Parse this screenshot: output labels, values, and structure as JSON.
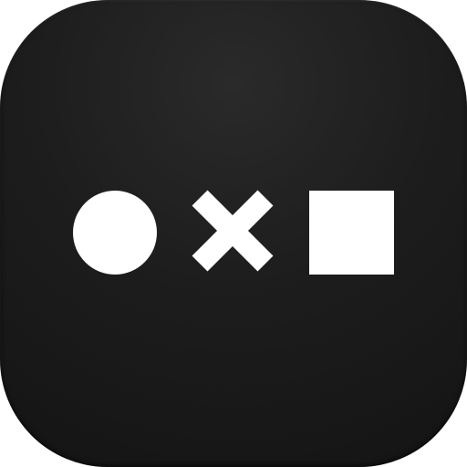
{
  "app_icon": {
    "icons": [
      "circle-icon",
      "x-cross-icon",
      "square-icon"
    ],
    "colors": {
      "background": "#1d1d1d",
      "glyph": "#ffffff"
    }
  }
}
